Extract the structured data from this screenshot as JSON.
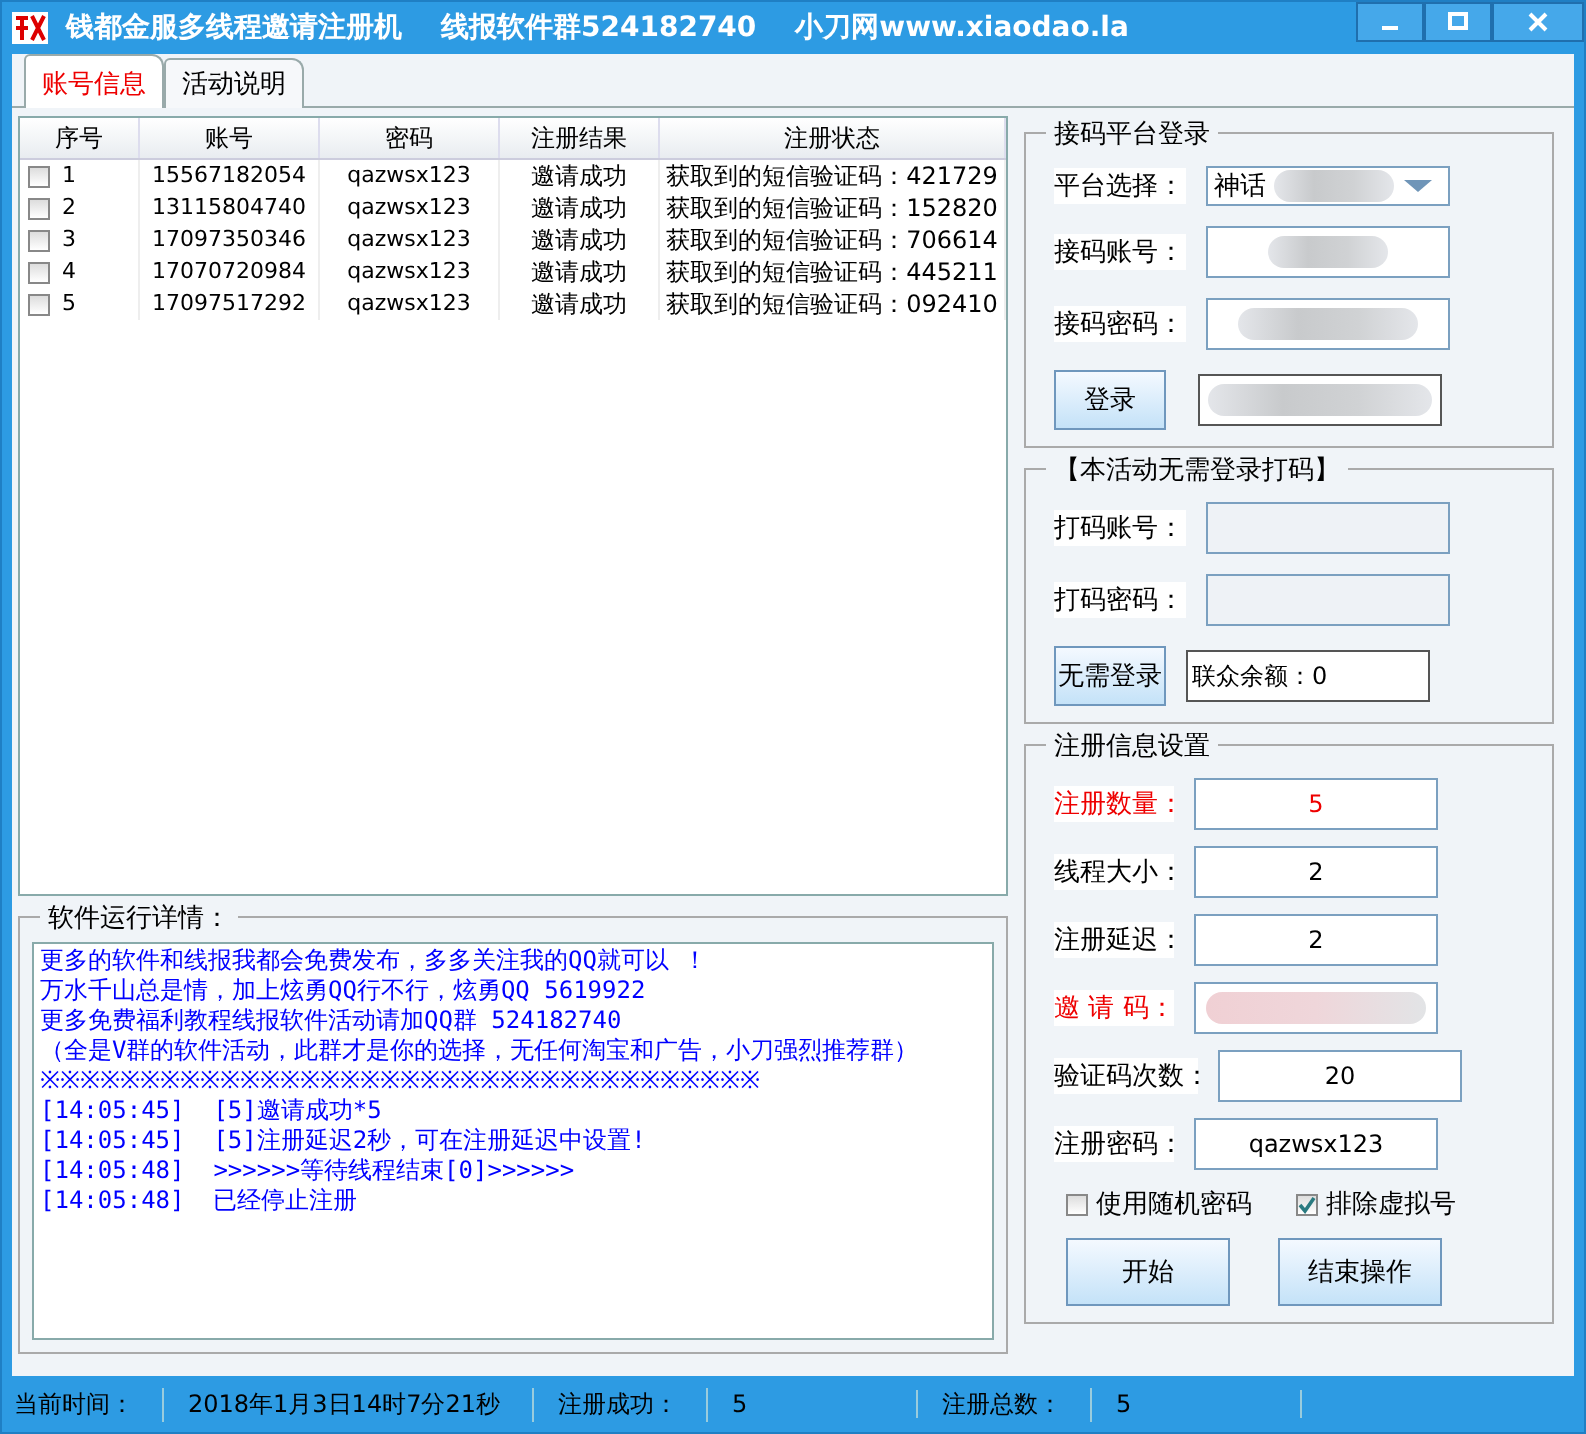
{
  "window": {
    "title": "钱都金服多线程邀请注册机    线报软件群524182740    小刀网www.xiaodao.la"
  },
  "tabs": [
    {
      "label": "账号信息",
      "selected": true
    },
    {
      "label": "活动说明",
      "selected": false
    }
  ],
  "table": {
    "columns": [
      "序号",
      "账号",
      "密码",
      "注册结果",
      "注册状态"
    ],
    "rows": [
      {
        "checked": false,
        "no": "1",
        "account": "15567182054",
        "password": "qazwsx123",
        "result": "邀请成功",
        "status": "获取到的短信验证码：421729"
      },
      {
        "checked": false,
        "no": "2",
        "account": "13115804740",
        "password": "qazwsx123",
        "result": "邀请成功",
        "status": "获取到的短信验证码：152820"
      },
      {
        "checked": false,
        "no": "3",
        "account": "17097350346",
        "password": "qazwsx123",
        "result": "邀请成功",
        "status": "获取到的短信验证码：706614"
      },
      {
        "checked": false,
        "no": "4",
        "account": "17070720984",
        "password": "qazwsx123",
        "result": "邀请成功",
        "status": "获取到的短信验证码：445211"
      },
      {
        "checked": false,
        "no": "5",
        "account": "17097517292",
        "password": "qazwsx123",
        "result": "邀请成功",
        "status": "获取到的短信验证码：092410"
      }
    ]
  },
  "log": {
    "title": "软件运行详情：",
    "lines": [
      "更多的软件和线报我都会免费发布，多多关注我的QQ就可以 ！",
      "万水千山总是情，加上炫勇QQ行不行，炫勇QQ 5619922",
      "更多免费福利教程线报软件活动请加QQ群 524182740",
      "（全是V群的软件活动，此群才是你的选择，无任何淘宝和广告，小刀强烈推荐群）",
      "※※※※※※※※※※※※※※※※※※※※※※※※※※※※※※※※※※※※",
      "[14:05:45]  [5]邀请成功*5",
      "[14:05:45]  [5]注册延迟2秒，可在注册延迟中设置!",
      "[14:05:48]  >>>>>>等待线程结束[0]>>>>>>",
      "[14:05:48]  已经停止注册"
    ]
  },
  "platform_login": {
    "title": "接码平台登录",
    "platform_label": "平台选择：",
    "platform_value": "神话",
    "account_label": "接码账号：",
    "password_label": "接码密码：",
    "login_button": "登录"
  },
  "captcha_login": {
    "title": "【本活动无需登录打码】",
    "account_label": "打码账号：",
    "password_label": "打码密码：",
    "button": "无需登录",
    "balance": "联众余额：0"
  },
  "settings": {
    "title": "注册信息设置",
    "fields": [
      {
        "label": "注册数量：",
        "value": "5",
        "highlighted": true,
        "kind": "text"
      },
      {
        "label": "线程大小：",
        "value": "2",
        "highlighted": false,
        "kind": "text"
      },
      {
        "label": "注册延迟：",
        "value": "2",
        "highlighted": false,
        "kind": "text"
      },
      {
        "label": "邀 请 码：",
        "highlighted": true,
        "kind": "redacted"
      },
      {
        "label": "验证码次数：",
        "value": "20",
        "highlighted": false,
        "kind": "text"
      },
      {
        "label": "注册密码：",
        "value": "qazwsx123",
        "highlighted": false,
        "kind": "text"
      }
    ],
    "options": [
      {
        "label": "使用随机密码",
        "checked": false
      },
      {
        "label": "排除虚拟号",
        "checked": true
      }
    ],
    "buttons": [
      "开始",
      "结束操作"
    ]
  },
  "status_bar": [
    {
      "label": "当前时间：",
      "value": "2018年1月3日14时7分21秒"
    },
    {
      "label": "注册成功：",
      "value": "5"
    },
    {
      "label": "注册总数：",
      "value": "5"
    }
  ]
}
